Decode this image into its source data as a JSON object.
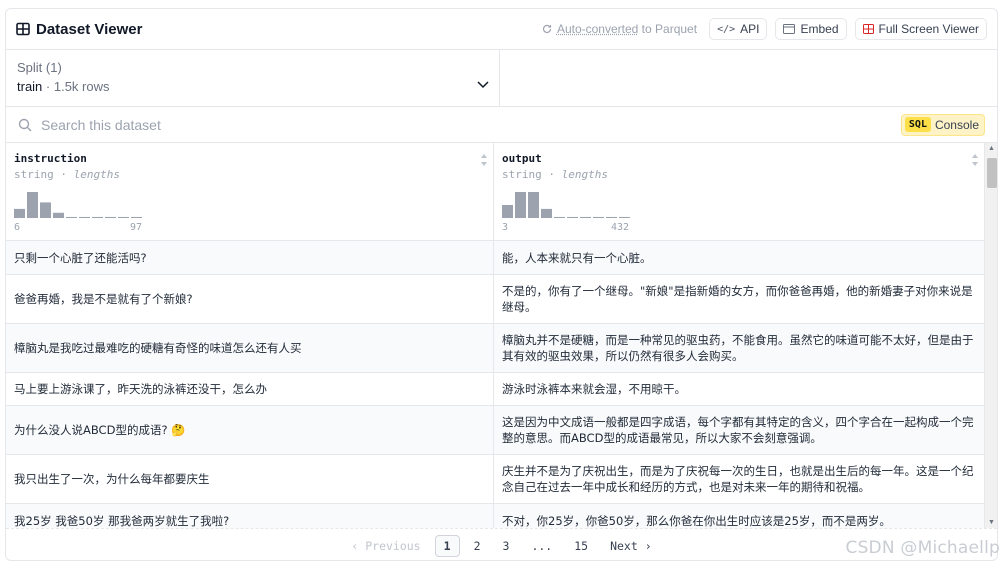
{
  "header": {
    "title": "Dataset Viewer",
    "auto_prefix": "Auto-converted",
    "auto_suffix": " to Parquet",
    "api_label": "API",
    "embed_label": "Embed",
    "fullscreen_label": "Full Screen Viewer"
  },
  "split": {
    "label": "Split (1)",
    "name": "train",
    "sep": " · ",
    "rows": "1.5k rows"
  },
  "search": {
    "placeholder": "Search this dataset",
    "sql_badge": "SQL",
    "console_label": "Console"
  },
  "columns": [
    {
      "name": "instruction",
      "type": "string",
      "stat": "lengths",
      "min": "6",
      "max": "97",
      "hist": [
        0.35,
        1.0,
        0.6,
        0.2,
        0.04,
        0.04,
        0.04,
        0.04,
        0.04,
        0.04
      ]
    },
    {
      "name": "output",
      "type": "string",
      "stat": "lengths",
      "min": "3",
      "max": "432",
      "hist": [
        0.5,
        1.0,
        1.0,
        0.35,
        0.04,
        0.04,
        0.04,
        0.04,
        0.04,
        0.04
      ]
    }
  ],
  "rows": [
    {
      "instruction": "只剩一个心脏了还能活吗?",
      "output": "能，人本来就只有一个心脏。"
    },
    {
      "instruction": "爸爸再婚，我是不是就有了个新娘?",
      "output": "不是的，你有了一个继母。\"新娘\"是指新婚的女方，而你爸爸再婚，他的新婚妻子对你来说是继母。"
    },
    {
      "instruction": "樟脑丸是我吃过最难吃的硬糖有奇怪的味道怎么还有人买",
      "output": "樟脑丸并不是硬糖，而是一种常见的驱虫药，不能食用。虽然它的味道可能不太好，但是由于其有效的驱虫效果，所以仍然有很多人会购买。"
    },
    {
      "instruction": "马上要上游泳课了，昨天洗的泳裤还没干，怎么办",
      "output": "游泳时泳裤本来就会湿，不用晾干。"
    },
    {
      "instruction": "为什么没人说ABCD型的成语? 🤔",
      "output": "这是因为中文成语一般都是四字成语，每个字都有其特定的含义，四个字合在一起构成一个完整的意思。而ABCD型的成语最常见，所以大家不会刻意强调。"
    },
    {
      "instruction": "我只出生了一次，为什么每年都要庆生",
      "output": "庆生并不是为了庆祝出生，而是为了庆祝每一次的生日，也就是出生后的每一年。这是一个纪念自己在过去一年中成长和经历的方式，也是对未来一年的期待和祝福。"
    },
    {
      "instruction": "我25岁 我爸50岁 那我爸两岁就生了我啦?",
      "output": "不对，你25岁，你爸50岁，那么你爸在你出生时应该是25岁，而不是两岁。"
    }
  ],
  "pager": {
    "previous": "‹ Previous",
    "pages": [
      "1",
      "2",
      "3",
      "...",
      "15"
    ],
    "current": "1",
    "next": "Next ›"
  },
  "watermark": "CSDN @Michaellp",
  "colors": {
    "accent_yellow": "#fde047",
    "fullscreen_red": "#dc2626",
    "bar_gray": "#9ca3af"
  }
}
